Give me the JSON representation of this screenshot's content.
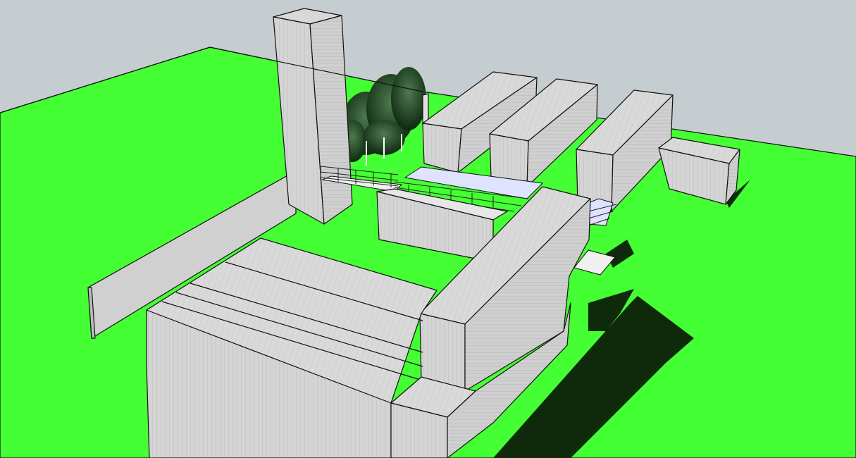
{
  "window": {
    "title": ""
  },
  "colors": {
    "sky": "#c6cdd0",
    "ground": "#44ff33",
    "roof": "#d9d9d9",
    "wall_light": "#e4e4e4",
    "wall_mid": "#cfcfcf",
    "wall_dark": "#bdbdbd",
    "shadow": "#0f2a0b",
    "glass": "#dfe3ff",
    "tree_dark": "#0d2a10",
    "tree_mid": "#3a6b3a",
    "edge": "#111111"
  },
  "model": {
    "description_visible_text": "",
    "objects": [
      "ground-plane",
      "tower-block",
      "tree-group",
      "container-blocks",
      "boundary-wall",
      "glass-deck",
      "railings"
    ]
  }
}
